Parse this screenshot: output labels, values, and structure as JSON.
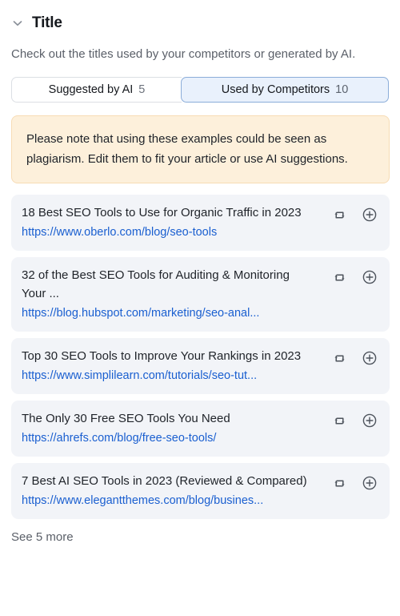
{
  "section": {
    "title": "Title",
    "collapse_icon": "chevron-down-icon",
    "description": "Check out the titles used by your competitors or generated by AI."
  },
  "tabs": [
    {
      "label": "Suggested by AI",
      "count": "5",
      "active": false
    },
    {
      "label": "Used by Competitors",
      "count": "10",
      "active": true
    }
  ],
  "notice": {
    "text": "Please note that using these examples could be seen as plagiarism. Edit them to fit your article or use AI suggestions.",
    "background_color": "#fdf0db",
    "border_color": "#f7dcb5"
  },
  "results": [
    {
      "title": "18 Best SEO Tools to Use for Organic Traffic in 2023",
      "url": "https://www.oberlo.com/blog/seo-tools",
      "replace_icon": "swap-icon",
      "add_icon": "plus-circle-icon"
    },
    {
      "title": "32 of the Best SEO Tools for Auditing & Monitoring Your ...",
      "url": "https://blog.hubspot.com/marketing/seo-anal...",
      "replace_icon": "swap-icon",
      "add_icon": "plus-circle-icon"
    },
    {
      "title": "Top 30 SEO Tools to Improve Your Rankings in 2023",
      "url": "https://www.simplilearn.com/tutorials/seo-tut...",
      "replace_icon": "swap-icon",
      "add_icon": "plus-circle-icon"
    },
    {
      "title": "The Only 30 Free SEO Tools You Need",
      "url": "https://ahrefs.com/blog/free-seo-tools/",
      "replace_icon": "swap-icon",
      "add_icon": "plus-circle-icon"
    },
    {
      "title": "7 Best AI SEO Tools in 2023 (Reviewed & Compared)",
      "url": "https://www.elegantthemes.com/blog/busines...",
      "replace_icon": "swap-icon",
      "add_icon": "plus-circle-icon"
    }
  ],
  "see_more": {
    "label": "See 5 more"
  },
  "colors": {
    "link": "#1a5fd0",
    "card_background": "#f2f4f8",
    "active_tab_background": "#e9f1fc",
    "active_tab_border": "#8badd9"
  }
}
